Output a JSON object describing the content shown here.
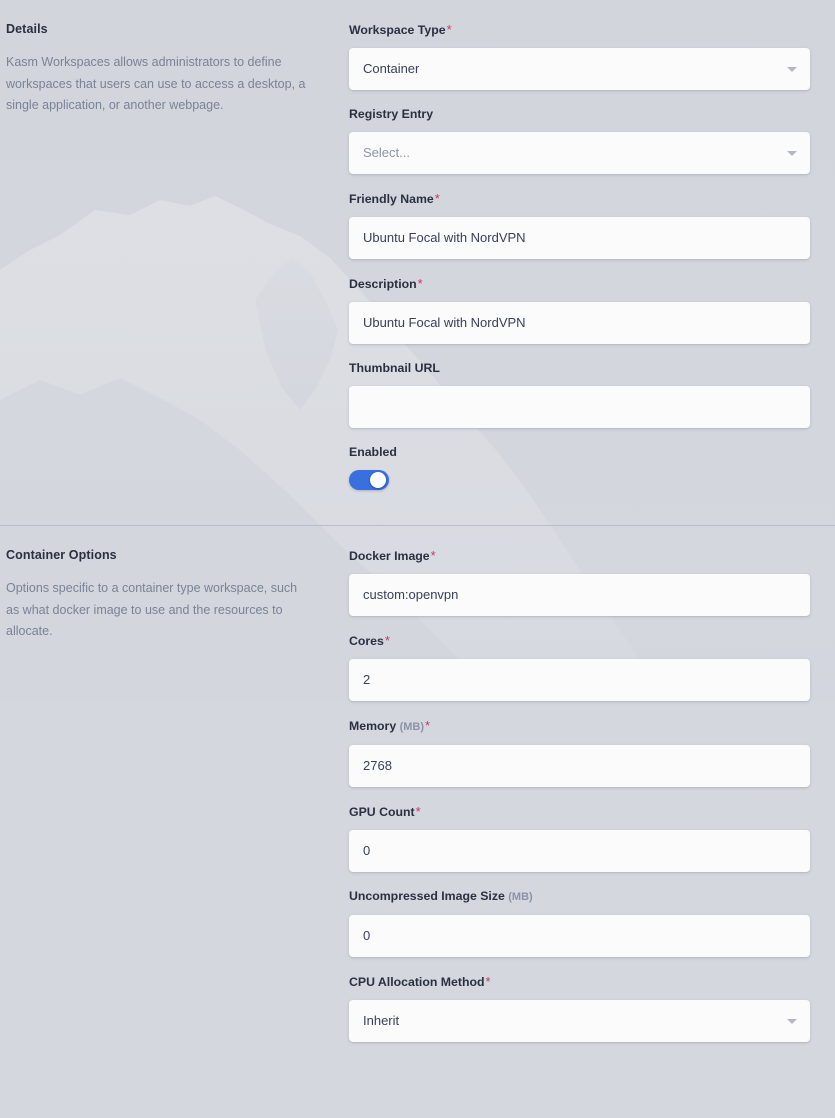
{
  "theme": {
    "background": "#d3d6dd",
    "label_color": "#2a3042",
    "muted_text": "#7a8296",
    "required_color": "#cf3463",
    "input_background": "#fbfbfc",
    "toggle_on_color": "#3a6fe0",
    "divider_color": "#b9bdc7"
  },
  "sections": [
    {
      "title": "Details",
      "description": "Kasm Workspaces allows administrators to define workspaces that users can use to access a desktop, a single application, or another webpage.",
      "fields": [
        {
          "label": "Workspace Type",
          "unit": "",
          "required": true,
          "type": "select",
          "value": "Container",
          "placeholder": ""
        },
        {
          "label": "Registry Entry",
          "unit": "",
          "required": false,
          "type": "select",
          "value": "",
          "placeholder": "Select..."
        },
        {
          "label": "Friendly Name",
          "unit": "",
          "required": true,
          "type": "text",
          "value": "Ubuntu Focal with NordVPN",
          "placeholder": ""
        },
        {
          "label": "Description",
          "unit": "",
          "required": true,
          "type": "text",
          "value": "Ubuntu Focal with NordVPN",
          "placeholder": ""
        },
        {
          "label": "Thumbnail URL",
          "unit": "",
          "required": false,
          "type": "text",
          "value": "",
          "placeholder": ""
        },
        {
          "label": "Enabled",
          "unit": "",
          "required": false,
          "type": "toggle",
          "value": "on",
          "placeholder": ""
        }
      ]
    },
    {
      "title": "Container Options",
      "description": "Options specific to a container type workspace, such as what docker image to use and the resources to allocate.",
      "fields": [
        {
          "label": "Docker Image",
          "unit": "",
          "required": true,
          "type": "text",
          "value": "custom:openvpn",
          "placeholder": ""
        },
        {
          "label": "Cores",
          "unit": "",
          "required": true,
          "type": "text",
          "value": "2",
          "placeholder": ""
        },
        {
          "label": "Memory",
          "unit": "(MB)",
          "required": true,
          "type": "text",
          "value": "2768",
          "placeholder": ""
        },
        {
          "label": "GPU Count",
          "unit": "",
          "required": true,
          "type": "text",
          "value": "0",
          "placeholder": ""
        },
        {
          "label": "Uncompressed Image Size",
          "unit": "(MB)",
          "required": false,
          "type": "text",
          "value": "0",
          "placeholder": ""
        },
        {
          "label": "CPU Allocation Method",
          "unit": "",
          "required": true,
          "type": "select",
          "value": "Inherit",
          "placeholder": ""
        }
      ]
    }
  ]
}
